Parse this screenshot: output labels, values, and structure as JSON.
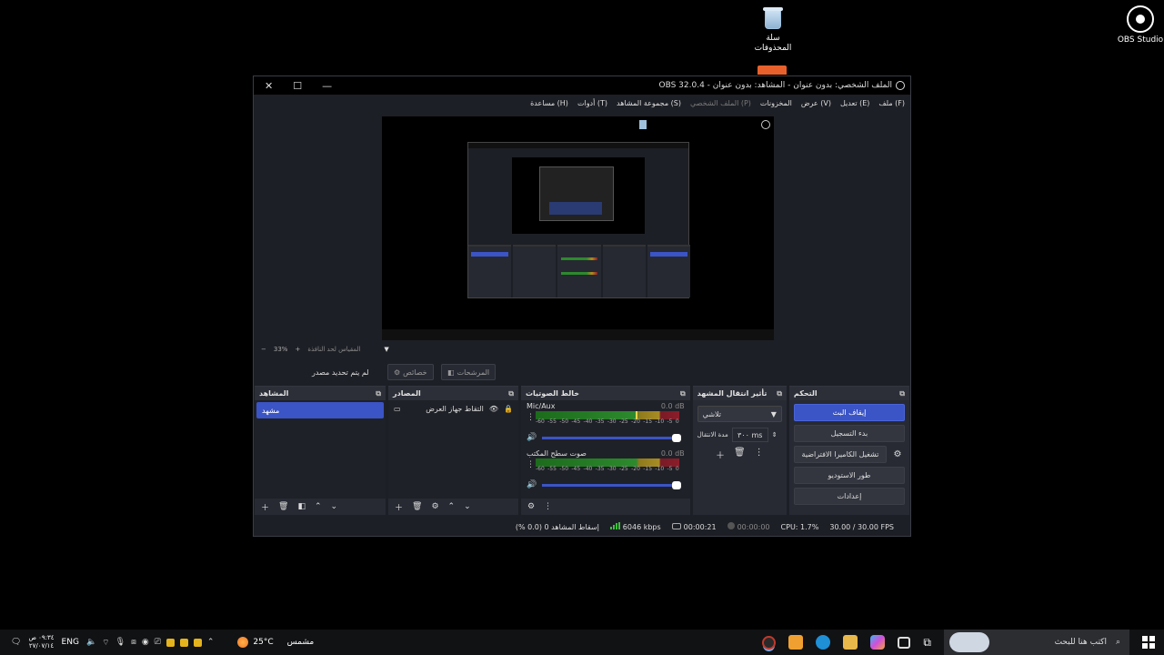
{
  "desktop": {
    "recycle_bin_label": "سلة\nالمحذوفات",
    "obs_label": "OBS Studio"
  },
  "window": {
    "title": "OBS 32.0.4 - الملف الشخصي: بدون عنوان - المشاهد: بدون عنوان",
    "minimize": "—",
    "maximize": "☐",
    "close": "✕"
  },
  "menu": [
    "ملف (F)",
    "تعديل (E)",
    "عرض (V)",
    "المخزونات",
    "الملف الشخصي (P)",
    "مجموعة المشاهد (S)",
    "أدوات (T)",
    "مساعدة (H)"
  ],
  "menu_disabled_index": 4,
  "preview": {
    "zoom_minus": "−",
    "zoom_value": "33%",
    "zoom_plus": "+",
    "fit_label": "المقياس لحد النافذة",
    "no_source": "لم يتم تحديد مصدر",
    "properties_label": "خصائص",
    "filters_label": "المرشحات"
  },
  "scenes": {
    "title": "المشاهد",
    "items": [
      "مشهد"
    ]
  },
  "sources": {
    "title": "المصادر",
    "items": [
      {
        "name": "التقاط جهاز العرض"
      }
    ]
  },
  "mixer": {
    "title": "خالط الصوتيات",
    "channels": [
      {
        "name": "Mic/Aux",
        "db": "0.0 dB",
        "level": 0.7
      },
      {
        "name": "صوت سطح المكتب",
        "db": "0.0 dB",
        "level": 0.0
      }
    ],
    "ticks": [
      "-60",
      "-55",
      "-50",
      "-45",
      "-40",
      "-35",
      "-30",
      "-25",
      "-20",
      "-15",
      "-10",
      "-5",
      "0"
    ]
  },
  "transitions": {
    "title": "تأثير انتقال المشهد",
    "selected": "تلاشي",
    "duration_label": "مدة الانتقال",
    "duration_value": "٣٠٠ ms"
  },
  "controls": {
    "title": "التحكم",
    "stop_stream": "إيقاف البث",
    "start_recording": "بدء التسجيل",
    "start_virtual_cam": "تشغيل الكاميرا الافتراضية",
    "studio_mode": "طور الاستوديو",
    "settings": "إعدادات"
  },
  "status": {
    "dropped": "إسقاط المشاهد 0 (0.0 %)",
    "bitrate": "6046 kbps",
    "stream_time": "00:00:21",
    "rec_time": "00:00:00",
    "cpu": "CPU: 1.7%",
    "fps": "30.00 / 30.00 FPS"
  },
  "taskbar": {
    "clock_time": "٠٩:٣٤ ص",
    "clock_date": "٢٧/٠٧/١٤",
    "lang": "ENG",
    "weather_temp": "25°C",
    "weather_desc": "مشمس",
    "search_placeholder": "اكتب هنا للبحث"
  },
  "colors": {
    "accent": "#3b54c6",
    "panel": "#272a33",
    "background": "#1d1f26"
  }
}
